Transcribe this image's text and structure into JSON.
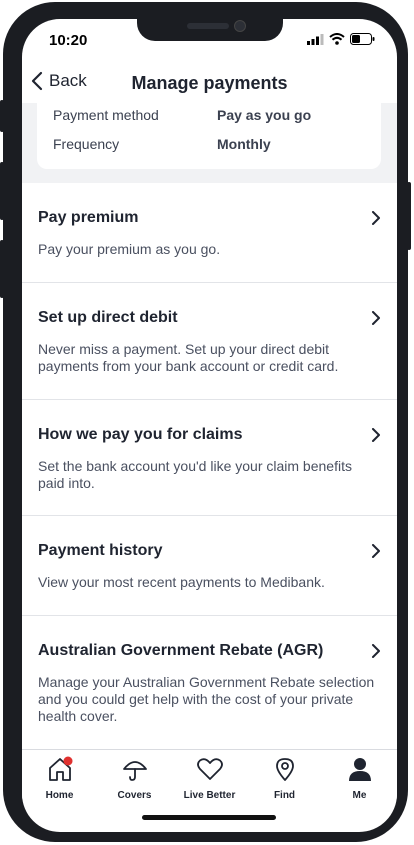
{
  "status_bar": {
    "time": "10:20"
  },
  "header": {
    "back_label": "Back",
    "title": "Manage payments"
  },
  "summary": {
    "rows": [
      {
        "label": "Payment method",
        "value": "Pay as you go"
      },
      {
        "label": "Frequency",
        "value": "Monthly"
      }
    ]
  },
  "items": [
    {
      "title": "Pay premium",
      "desc": "Pay your premium as you go."
    },
    {
      "title": "Set up direct debit",
      "desc": "Never miss a payment. Set up your direct debit payments from your bank account or credit card."
    },
    {
      "title": "How we pay you for claims",
      "desc": "Set the bank account you'd like your claim benefits paid into."
    },
    {
      "title": "Payment history",
      "desc": "View your most recent payments to Medibank."
    },
    {
      "title": "Australian Government Rebate (AGR)",
      "desc": "Manage your Australian Government Rebate selection and you could get help with the cost of your private health cover."
    }
  ],
  "tabs": [
    {
      "label": "Home",
      "icon": "home-icon"
    },
    {
      "label": "Covers",
      "icon": "umbrella-icon"
    },
    {
      "label": "Live Better",
      "icon": "heart-icon"
    },
    {
      "label": "Find",
      "icon": "location-pin-icon"
    },
    {
      "label": "Me",
      "icon": "person-icon"
    }
  ],
  "colors": {
    "badge": "#e0312f",
    "text": "#1f2430",
    "divider": "#e2e4e8",
    "summary_bg": "#f1f2f4"
  }
}
